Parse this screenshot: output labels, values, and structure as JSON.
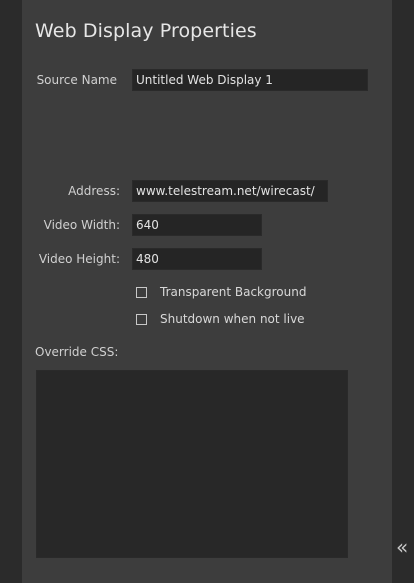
{
  "panel": {
    "title": "Web Display Properties"
  },
  "fields": {
    "source_name": {
      "label": "Source Name",
      "value": "Untitled Web Display 1"
    },
    "address": {
      "label": "Address:",
      "value": "www.telestream.net/wirecast/"
    },
    "video_width": {
      "label": "Video Width:",
      "value": "640"
    },
    "video_height": {
      "label": "Video Height:",
      "value": "480"
    }
  },
  "options": {
    "transparent_background": {
      "label": "Transparent Background",
      "checked": false
    },
    "shutdown_when_not_live": {
      "label": "Shutdown when not live",
      "checked": false
    }
  },
  "override_css": {
    "label": "Override CSS:",
    "value": ""
  },
  "collapse_button": {
    "glyph": "«",
    "icon": "double-chevron-left-icon"
  }
}
